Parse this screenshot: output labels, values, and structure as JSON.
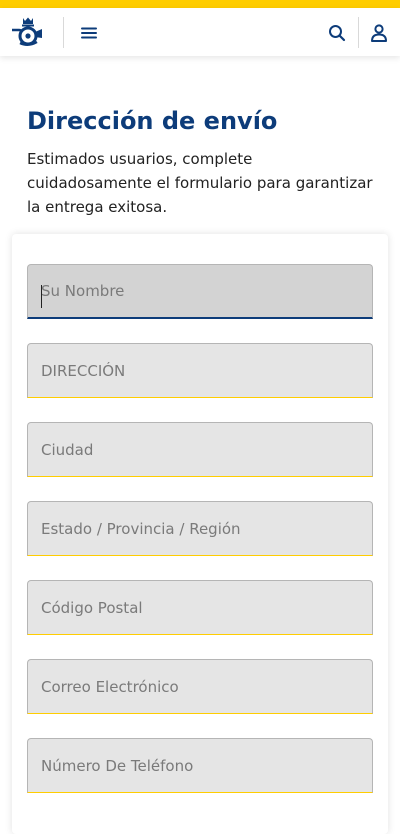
{
  "colors": {
    "brand_yellow": "#ffcd00",
    "brand_blue": "#0d3c7a",
    "field_background": "#e5e5e5",
    "field_active_background": "#d3d3d3"
  },
  "header": {
    "logo_icon": "posthorn-crown-logo-icon",
    "menu_icon": "hamburger-menu-icon",
    "search_icon": "search-icon",
    "user_icon": "user-account-icon"
  },
  "page": {
    "title": "Dirección de envío",
    "intro": "Estimados usuarios, complete cuidadosamente el formulario para garantizar la entrega exitosa."
  },
  "form": {
    "fields": [
      {
        "placeholder": "Su Nombre",
        "value": ""
      },
      {
        "placeholder": "DIRECCIÓN",
        "value": ""
      },
      {
        "placeholder": "Ciudad",
        "value": ""
      },
      {
        "placeholder": "Estado / Provincia / Región",
        "value": ""
      },
      {
        "placeholder": "Código Postal",
        "value": ""
      },
      {
        "placeholder": "Correo Electrónico",
        "value": ""
      },
      {
        "placeholder": "Número De Teléfono",
        "value": ""
      }
    ]
  }
}
